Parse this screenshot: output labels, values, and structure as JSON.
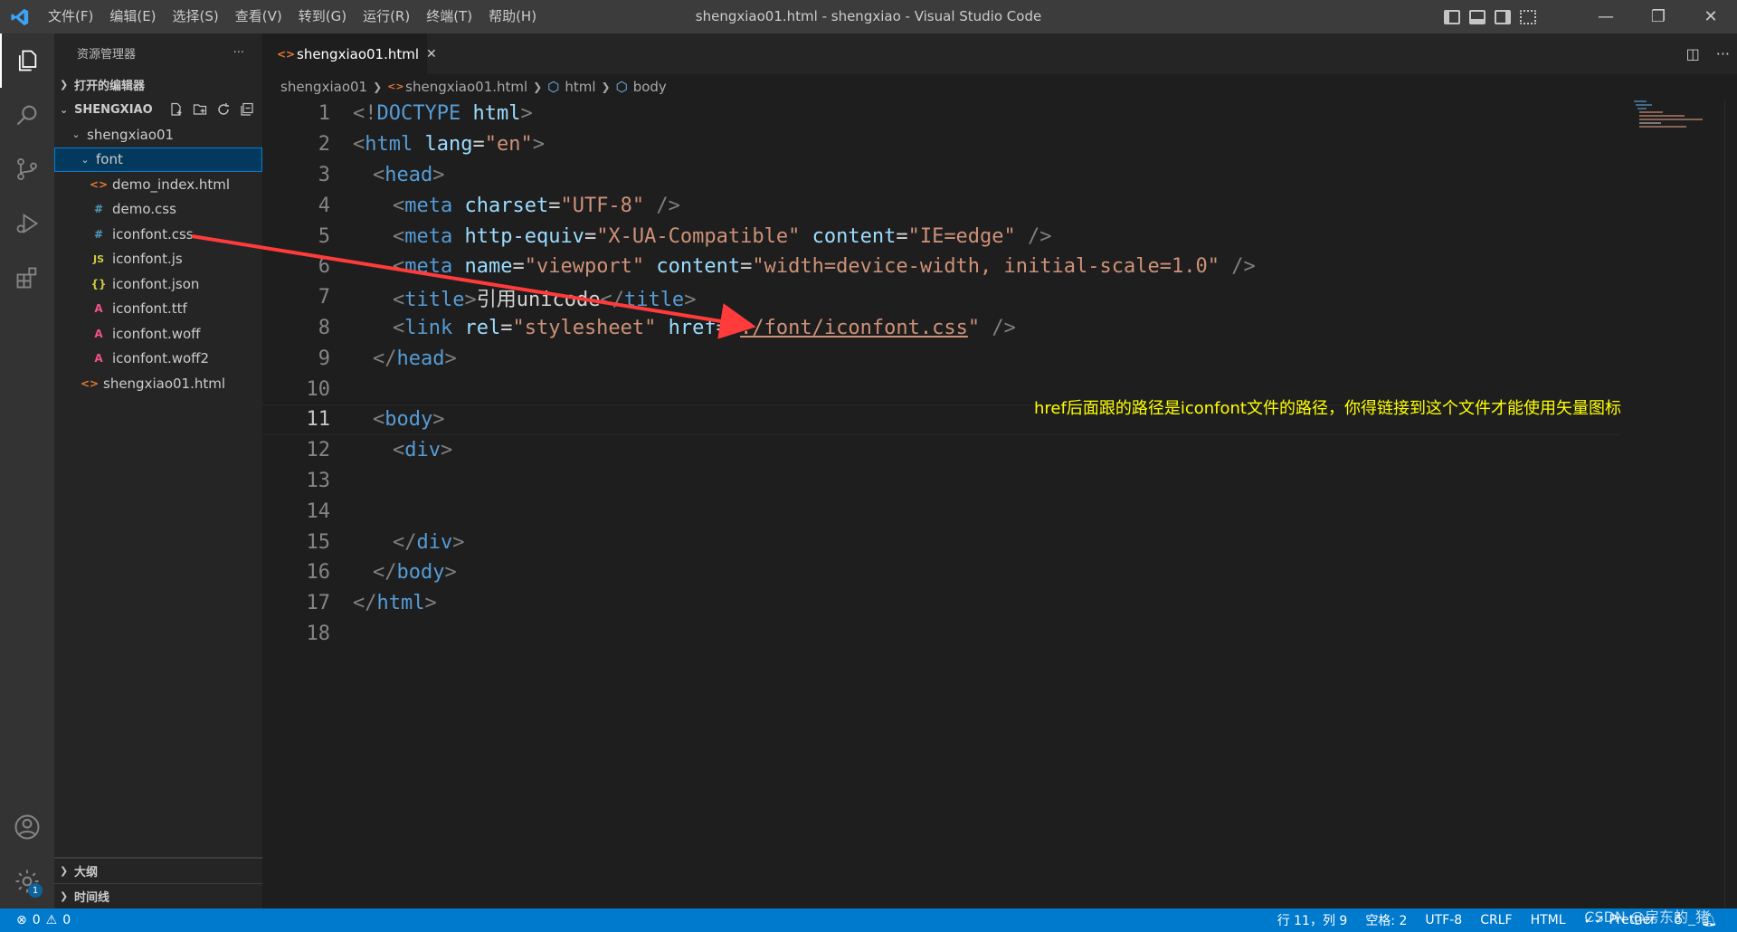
{
  "titlebar": {
    "menus": [
      "文件(F)",
      "编辑(E)",
      "选择(S)",
      "查看(V)",
      "转到(G)",
      "运行(R)",
      "终端(T)",
      "帮助(H)"
    ],
    "window_title": "shengxiao01.html - shengxiao - Visual Studio Code"
  },
  "sidebar": {
    "title": "资源管理器",
    "more": "···",
    "open_editors": "打开的编辑器",
    "workspace": "SHENGXIAO",
    "tree": [
      {
        "label": "shengxiao01",
        "type": "folder"
      },
      {
        "label": "font",
        "type": "folder"
      },
      {
        "label": "demo_index.html",
        "type": "html"
      },
      {
        "label": "demo.css",
        "type": "css"
      },
      {
        "label": "iconfont.css",
        "type": "css"
      },
      {
        "label": "iconfont.js",
        "type": "js"
      },
      {
        "label": "iconfont.json",
        "type": "json"
      },
      {
        "label": "iconfont.ttf",
        "type": "font"
      },
      {
        "label": "iconfont.woff",
        "type": "font"
      },
      {
        "label": "iconfont.woff2",
        "type": "font"
      },
      {
        "label": "shengxiao01.html",
        "type": "html"
      }
    ],
    "outline": "大纲",
    "timeline": "时间线"
  },
  "editor": {
    "tab_label": "shengxiao01.html",
    "breadcrumbs": [
      "shengxiao01",
      "shengxiao01.html",
      "html",
      "body"
    ],
    "line_numbers": [
      "1",
      "2",
      "3",
      "4",
      "5",
      "6",
      "7",
      "8",
      "9",
      "10",
      "11",
      "12",
      "13",
      "14",
      "15",
      "16",
      "17",
      "18"
    ],
    "current_line": "11",
    "annotation": "href后面跟的路径是iconfont文件的路径，你得链接到这个文件才能使用矢量图标"
  },
  "code": {
    "l1": [
      "<!",
      "DOCTYPE",
      " html",
      ">"
    ],
    "l2": [
      "<",
      "html",
      " lang",
      "=",
      "\"en\"",
      ">"
    ],
    "l3": [
      "<",
      "head",
      ">"
    ],
    "l4": [
      "<",
      "meta",
      " charset",
      "=",
      "\"UTF-8\"",
      " />"
    ],
    "l5": [
      "<",
      "meta",
      " http-equiv",
      "=",
      "\"X-UA-Compatible\"",
      " content",
      "=",
      "\"IE=edge\"",
      " />"
    ],
    "l6": [
      "<",
      "meta",
      " name",
      "=",
      "\"viewport\"",
      " content",
      "=",
      "\"width=device-width, initial-scale=1.0\"",
      " />"
    ],
    "l7": [
      "<",
      "title",
      ">",
      "引用unicode",
      "</",
      "title",
      ">"
    ],
    "l8": [
      "<",
      "link",
      " rel",
      "=",
      "\"stylesheet\"",
      " href",
      "=",
      "\"",
      "./font/iconfont.css",
      "\"",
      " />"
    ],
    "l9": [
      "</",
      "head",
      ">"
    ],
    "l11": [
      "<",
      "body",
      ">"
    ],
    "l12": [
      "<",
      "div",
      ">"
    ],
    "l15": [
      "</",
      "div",
      ">"
    ],
    "l16": [
      "</",
      "body",
      ">"
    ],
    "l17": [
      "</",
      "html",
      ">"
    ]
  },
  "statusbar": {
    "errors": "0",
    "warnings": "0",
    "position": "行 11，列 9",
    "spaces": "空格: 2",
    "encoding": "UTF-8",
    "eol": "CRLF",
    "language": "HTML",
    "prettier": "Prettier",
    "watermark": "CSDN @房东的_猪"
  },
  "colors": {
    "statusbar": "#007acc",
    "annotation": "#ffff00",
    "arrow": "#ff3b3b"
  }
}
